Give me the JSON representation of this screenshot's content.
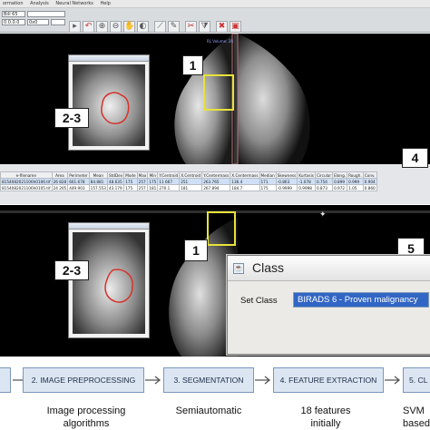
{
  "menubar": {
    "items": [
      "ormation",
      "Analysis",
      "Neural Networks",
      "Help"
    ]
  },
  "toolbar": {
    "field1": "Bill 65",
    "field2": "0x0",
    "field3": "0.0.0.0"
  },
  "viewer_top": {
    "label": "RL Volume: 2R"
  },
  "callouts": {
    "one_top": "1",
    "two_three_top": "2-3",
    "four": "4",
    "one_bottom": "1",
    "two_three_bottom": "2-3",
    "five": "5"
  },
  "table": {
    "headers": [
      "e-filename",
      "Area",
      "Perimeter",
      "Mean",
      "StdDev",
      "Mode",
      "Max",
      "Min",
      "Y.Centroid",
      "X.Centroid",
      "Y.Centermass",
      "X.Centermass",
      "Median",
      "Skewness",
      "Kurtosis",
      "Circular",
      "Elong.",
      "Rough.",
      "Conv."
    ],
    "rows": [
      [
        "8154082021106h0106.tif",
        "26 828",
        "661.678",
        "84.881",
        "48.635",
        "175",
        "257",
        "175",
        "11 667",
        "251",
        "263.765",
        "136.4",
        "171",
        "-0.863",
        "-1.078",
        "0.754",
        "0.899",
        "0.999",
        "0.904"
      ],
      [
        "8154082021106h0105.tif",
        "24 205",
        "449.903",
        "157.553",
        "43.179",
        "175",
        "257",
        "181",
        "270.1",
        "181",
        "267.894",
        "184.7",
        "175",
        "-0.9999",
        "0.9998",
        "0.873",
        "0.972",
        "1.05",
        "0.860"
      ]
    ]
  },
  "dialog": {
    "title": "Class",
    "set_class_label": "Set Class",
    "selected_class": "BIRADS 6 - Proven malignancy"
  },
  "pipeline": {
    "steps": [
      {
        "label": ""
      },
      {
        "label": "2. IMAGE PREPROCESSING"
      },
      {
        "label": "3. SEGMENTATION"
      },
      {
        "label": "4. FEATURE EXTRACTION"
      },
      {
        "label": "5. CL"
      }
    ],
    "descriptions": [
      {
        "line1": "Image processing",
        "line2": "algorithms"
      },
      {
        "line1": "Semiautomatic",
        "line2": ""
      },
      {
        "line1": "18 features",
        "line2": "initially"
      },
      {
        "line1": "SVM",
        "line2": "based"
      }
    ]
  },
  "colors": {
    "yellow_roi": "#e8e23a",
    "tumour_outline": "#d6332b",
    "selection": "#3166c4",
    "pipe_fill": "#dce6f2",
    "pipe_border": "#7a97bd"
  }
}
